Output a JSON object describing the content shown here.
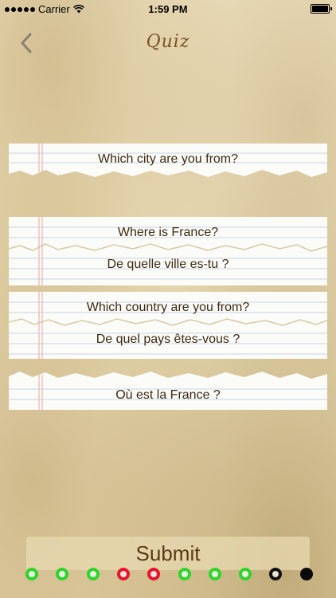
{
  "status_bar": {
    "carrier": "Carrier",
    "time": "1:59 PM"
  },
  "nav": {
    "title": "Quiz",
    "back_icon": "chevron-left-icon"
  },
  "cards": [
    {
      "labels": [
        "Which city are you from?"
      ]
    },
    {
      "labels": [
        "Where is France?",
        "De quelle ville es-tu ?"
      ]
    },
    {
      "labels": [
        "Which country are you from?",
        "De quel pays êtes-vous ?"
      ]
    },
    {
      "labels": [
        "Où est la France ?"
      ]
    }
  ],
  "submit_label": "Submit",
  "progress": [
    "correct",
    "correct",
    "correct",
    "wrong",
    "wrong",
    "correct",
    "correct",
    "correct",
    "current",
    "pending"
  ],
  "colors": {
    "correct": "#2fd42c",
    "wrong": "#e8142a",
    "text_brown": "#3e2a12",
    "title_brown": "#7a5224"
  }
}
